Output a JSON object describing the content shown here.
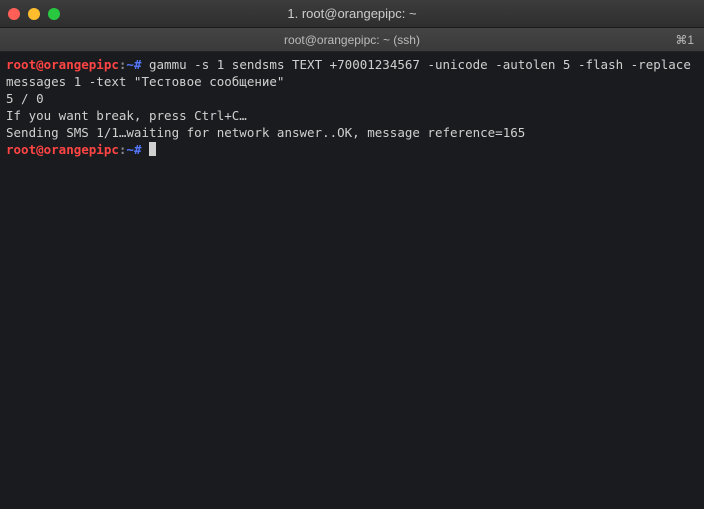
{
  "window": {
    "title": "1. root@orangepipc: ~"
  },
  "tab": {
    "label": "root@orangepipc: ~ (ssh)",
    "indicator": "⌘1"
  },
  "prompt": {
    "user_host": "root@orangepipc",
    "sep": ":",
    "path": "~#"
  },
  "lines": {
    "cmd1": " gammu -s 1 sendsms TEXT +70001234567 -unicode -autolen 5 -flash -replacemessages 1 -text \"Тестовое сообщение\"",
    "out1": "5 / 0",
    "out2": "If you want break, press Ctrl+C…",
    "out3": "Sending SMS 1/1…waiting for network answer..OK, message reference=165",
    "cmd2": " "
  }
}
